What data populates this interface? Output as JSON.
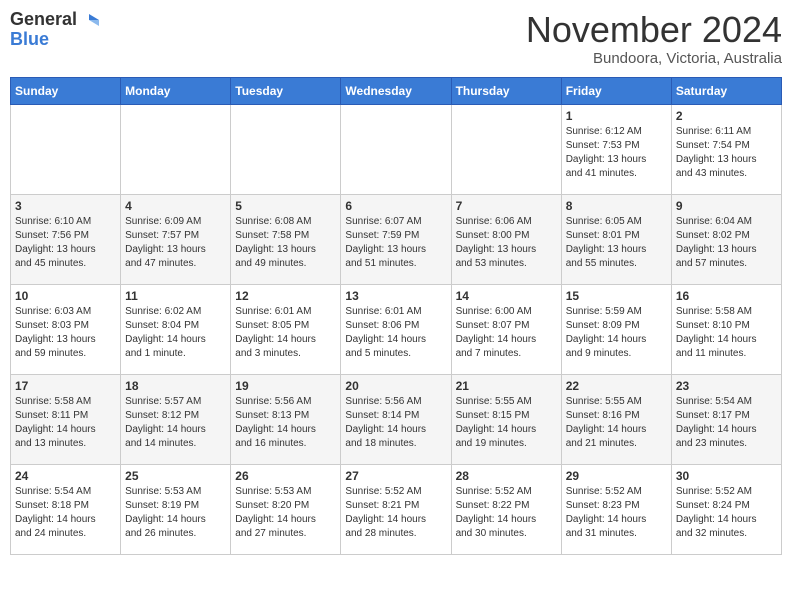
{
  "header": {
    "logo_line1": "General",
    "logo_line2": "Blue",
    "month": "November 2024",
    "location": "Bundoora, Victoria, Australia"
  },
  "weekdays": [
    "Sunday",
    "Monday",
    "Tuesday",
    "Wednesday",
    "Thursday",
    "Friday",
    "Saturday"
  ],
  "weeks": [
    [
      {
        "day": "",
        "info": ""
      },
      {
        "day": "",
        "info": ""
      },
      {
        "day": "",
        "info": ""
      },
      {
        "day": "",
        "info": ""
      },
      {
        "day": "",
        "info": ""
      },
      {
        "day": "1",
        "info": "Sunrise: 6:12 AM\nSunset: 7:53 PM\nDaylight: 13 hours\nand 41 minutes."
      },
      {
        "day": "2",
        "info": "Sunrise: 6:11 AM\nSunset: 7:54 PM\nDaylight: 13 hours\nand 43 minutes."
      }
    ],
    [
      {
        "day": "3",
        "info": "Sunrise: 6:10 AM\nSunset: 7:56 PM\nDaylight: 13 hours\nand 45 minutes."
      },
      {
        "day": "4",
        "info": "Sunrise: 6:09 AM\nSunset: 7:57 PM\nDaylight: 13 hours\nand 47 minutes."
      },
      {
        "day": "5",
        "info": "Sunrise: 6:08 AM\nSunset: 7:58 PM\nDaylight: 13 hours\nand 49 minutes."
      },
      {
        "day": "6",
        "info": "Sunrise: 6:07 AM\nSunset: 7:59 PM\nDaylight: 13 hours\nand 51 minutes."
      },
      {
        "day": "7",
        "info": "Sunrise: 6:06 AM\nSunset: 8:00 PM\nDaylight: 13 hours\nand 53 minutes."
      },
      {
        "day": "8",
        "info": "Sunrise: 6:05 AM\nSunset: 8:01 PM\nDaylight: 13 hours\nand 55 minutes."
      },
      {
        "day": "9",
        "info": "Sunrise: 6:04 AM\nSunset: 8:02 PM\nDaylight: 13 hours\nand 57 minutes."
      }
    ],
    [
      {
        "day": "10",
        "info": "Sunrise: 6:03 AM\nSunset: 8:03 PM\nDaylight: 13 hours\nand 59 minutes."
      },
      {
        "day": "11",
        "info": "Sunrise: 6:02 AM\nSunset: 8:04 PM\nDaylight: 14 hours\nand 1 minute."
      },
      {
        "day": "12",
        "info": "Sunrise: 6:01 AM\nSunset: 8:05 PM\nDaylight: 14 hours\nand 3 minutes."
      },
      {
        "day": "13",
        "info": "Sunrise: 6:01 AM\nSunset: 8:06 PM\nDaylight: 14 hours\nand 5 minutes."
      },
      {
        "day": "14",
        "info": "Sunrise: 6:00 AM\nSunset: 8:07 PM\nDaylight: 14 hours\nand 7 minutes."
      },
      {
        "day": "15",
        "info": "Sunrise: 5:59 AM\nSunset: 8:09 PM\nDaylight: 14 hours\nand 9 minutes."
      },
      {
        "day": "16",
        "info": "Sunrise: 5:58 AM\nSunset: 8:10 PM\nDaylight: 14 hours\nand 11 minutes."
      }
    ],
    [
      {
        "day": "17",
        "info": "Sunrise: 5:58 AM\nSunset: 8:11 PM\nDaylight: 14 hours\nand 13 minutes."
      },
      {
        "day": "18",
        "info": "Sunrise: 5:57 AM\nSunset: 8:12 PM\nDaylight: 14 hours\nand 14 minutes."
      },
      {
        "day": "19",
        "info": "Sunrise: 5:56 AM\nSunset: 8:13 PM\nDaylight: 14 hours\nand 16 minutes."
      },
      {
        "day": "20",
        "info": "Sunrise: 5:56 AM\nSunset: 8:14 PM\nDaylight: 14 hours\nand 18 minutes."
      },
      {
        "day": "21",
        "info": "Sunrise: 5:55 AM\nSunset: 8:15 PM\nDaylight: 14 hours\nand 19 minutes."
      },
      {
        "day": "22",
        "info": "Sunrise: 5:55 AM\nSunset: 8:16 PM\nDaylight: 14 hours\nand 21 minutes."
      },
      {
        "day": "23",
        "info": "Sunrise: 5:54 AM\nSunset: 8:17 PM\nDaylight: 14 hours\nand 23 minutes."
      }
    ],
    [
      {
        "day": "24",
        "info": "Sunrise: 5:54 AM\nSunset: 8:18 PM\nDaylight: 14 hours\nand 24 minutes."
      },
      {
        "day": "25",
        "info": "Sunrise: 5:53 AM\nSunset: 8:19 PM\nDaylight: 14 hours\nand 26 minutes."
      },
      {
        "day": "26",
        "info": "Sunrise: 5:53 AM\nSunset: 8:20 PM\nDaylight: 14 hours\nand 27 minutes."
      },
      {
        "day": "27",
        "info": "Sunrise: 5:52 AM\nSunset: 8:21 PM\nDaylight: 14 hours\nand 28 minutes."
      },
      {
        "day": "28",
        "info": "Sunrise: 5:52 AM\nSunset: 8:22 PM\nDaylight: 14 hours\nand 30 minutes."
      },
      {
        "day": "29",
        "info": "Sunrise: 5:52 AM\nSunset: 8:23 PM\nDaylight: 14 hours\nand 31 minutes."
      },
      {
        "day": "30",
        "info": "Sunrise: 5:52 AM\nSunset: 8:24 PM\nDaylight: 14 hours\nand 32 minutes."
      }
    ]
  ]
}
